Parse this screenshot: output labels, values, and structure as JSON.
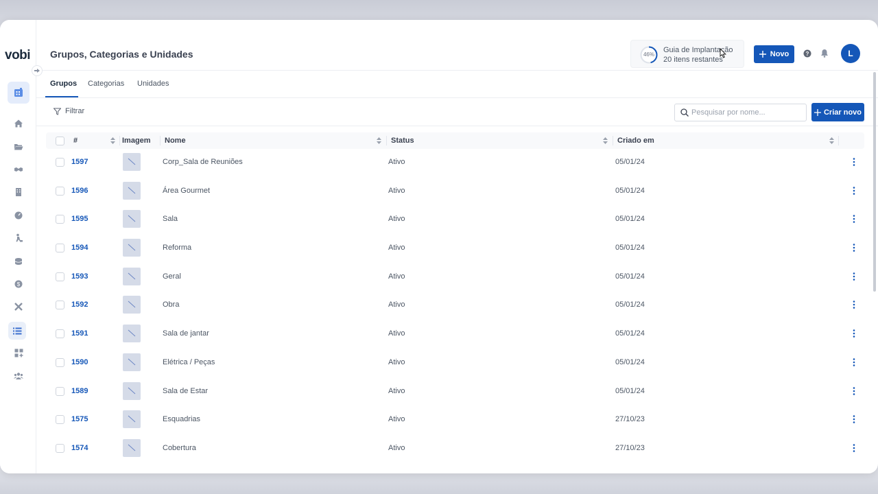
{
  "app": {
    "logo": "vobi",
    "page_title": "Grupos, Categorias e Unidades"
  },
  "guide": {
    "percent": "46%",
    "percent_value": 46,
    "title": "Guia de Implantação",
    "subtitle": "20 itens restantes"
  },
  "header": {
    "new_button": "Novo",
    "avatar_initial": "L"
  },
  "tabs": [
    {
      "label": "Grupos",
      "active": true
    },
    {
      "label": "Categorias",
      "active": false
    },
    {
      "label": "Unidades",
      "active": false
    }
  ],
  "toolbar": {
    "filter_label": "Filtrar",
    "search_placeholder": "Pesquisar por nome...",
    "create_button": "Criar novo"
  },
  "table": {
    "columns": [
      "#",
      "Imagem",
      "Nome",
      "Status",
      "Criado em"
    ],
    "rows": [
      {
        "id": "1597",
        "name": "Corp_Sala de Reuniões",
        "status": "Ativo",
        "created": "05/01/24"
      },
      {
        "id": "1596",
        "name": "Área Gourmet",
        "status": "Ativo",
        "created": "05/01/24"
      },
      {
        "id": "1595",
        "name": "Sala",
        "status": "Ativo",
        "created": "05/01/24"
      },
      {
        "id": "1594",
        "name": "Reforma",
        "status": "Ativo",
        "created": "05/01/24"
      },
      {
        "id": "1593",
        "name": "Geral",
        "status": "Ativo",
        "created": "05/01/24"
      },
      {
        "id": "1592",
        "name": "Obra",
        "status": "Ativo",
        "created": "05/01/24"
      },
      {
        "id": "1591",
        "name": "Sala de jantar",
        "status": "Ativo",
        "created": "05/01/24"
      },
      {
        "id": "1590",
        "name": "Elétrica / Peças",
        "status": "Ativo",
        "created": "05/01/24"
      },
      {
        "id": "1589",
        "name": "Sala de Estar",
        "status": "Ativo",
        "created": "05/01/24"
      },
      {
        "id": "1575",
        "name": "Esquadrias",
        "status": "Ativo",
        "created": "27/10/23"
      },
      {
        "id": "1574",
        "name": "Cobertura",
        "status": "Ativo",
        "created": "27/10/23"
      }
    ]
  },
  "colors": {
    "primary": "#1557b8",
    "thumb": "#d5dbe8"
  },
  "sidebar": {
    "icons": [
      "dashboard-icon",
      "home-icon",
      "folder-icon",
      "handshake-icon",
      "building-icon",
      "gauge-icon",
      "worker-icon",
      "coins-icon",
      "dollar-icon",
      "tools-icon",
      "list-icon",
      "apps-add-icon",
      "team-icon"
    ]
  }
}
